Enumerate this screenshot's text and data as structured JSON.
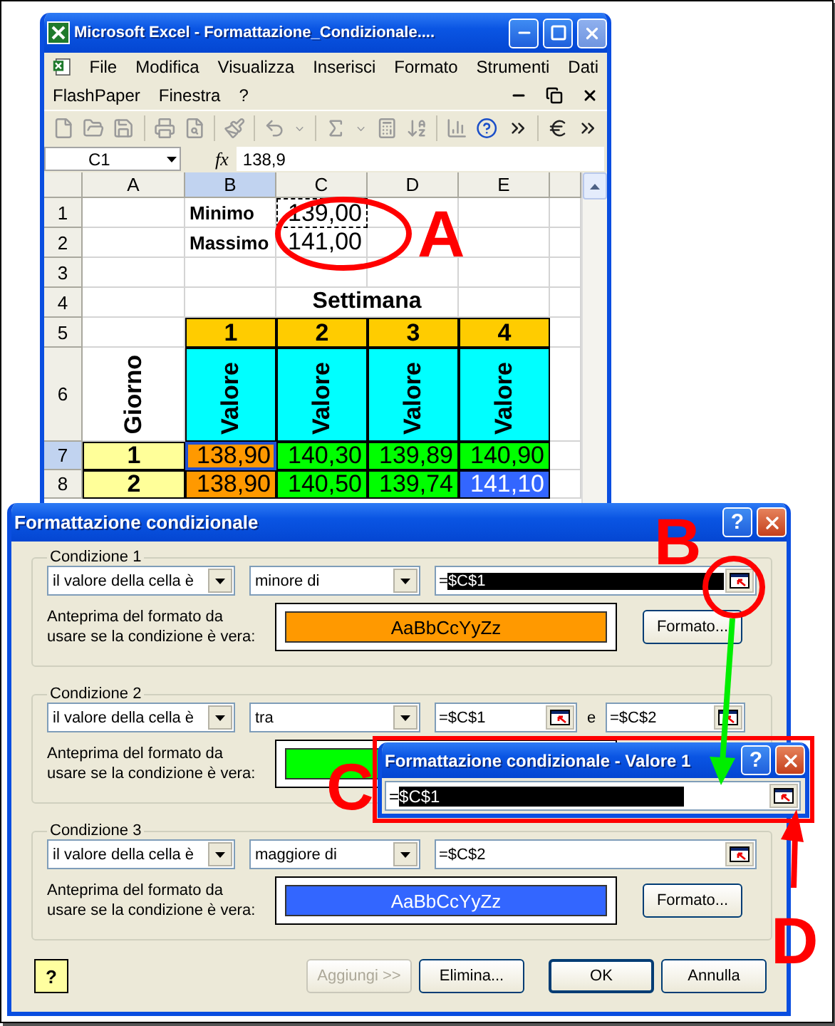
{
  "excel": {
    "title": "Microsoft Excel - Formattazione_Condizionale....",
    "menus": [
      [
        "File",
        "Modifica",
        "Visualizza",
        "Inserisci",
        "Formato",
        "Strumenti",
        "Dati"
      ],
      [
        "FlashPaper",
        "Finestra",
        "?"
      ]
    ],
    "name_box": "C1",
    "fx": "fx",
    "formula": "138,9",
    "columns": [
      {
        "label": "A",
        "selected": false
      },
      {
        "label": "B",
        "selected": true
      },
      {
        "label": "C",
        "selected": false
      },
      {
        "label": "D",
        "selected": false
      },
      {
        "label": "E",
        "selected": false
      }
    ],
    "rows": [
      {
        "header": "1",
        "selected": false,
        "cells": [
          {
            "kind": "empty"
          },
          {
            "kind": "label",
            "text": "Minimo"
          },
          {
            "kind": "reference",
            "text": "139,00"
          },
          {
            "kind": "empty"
          },
          {
            "kind": "empty"
          }
        ]
      },
      {
        "header": "2",
        "selected": false,
        "cells": [
          {
            "kind": "empty"
          },
          {
            "kind": "label",
            "text": "Massimo"
          },
          {
            "kind": "value",
            "text": "141,00"
          },
          {
            "kind": "empty"
          },
          {
            "kind": "empty"
          }
        ]
      },
      {
        "header": "3",
        "selected": false,
        "cells": [
          {
            "kind": "empty"
          },
          {
            "kind": "empty"
          },
          {
            "kind": "empty"
          },
          {
            "kind": "empty"
          },
          {
            "kind": "empty"
          }
        ]
      },
      {
        "header": "4",
        "selected": false,
        "cells": [
          {
            "kind": "empty"
          },
          {
            "kind": "empty"
          },
          {
            "kind": "title",
            "text": "Settimana"
          },
          {
            "kind": "empty"
          }
        ]
      },
      {
        "header": "5",
        "selected": false,
        "cells": [
          {
            "kind": "empty"
          },
          {
            "kind": "heading",
            "text": "1",
            "color": "#ffcc00"
          },
          {
            "kind": "heading",
            "text": "2",
            "color": "#ffcc00"
          },
          {
            "kind": "heading",
            "text": "3",
            "color": "#ffcc00"
          },
          {
            "kind": "heading",
            "text": "4",
            "color": "#ffcc00"
          }
        ]
      },
      {
        "header": "6",
        "selected": false,
        "cells": [
          {
            "kind": "vertical",
            "text": "Giorno"
          },
          {
            "kind": "vertical",
            "text": "Valore",
            "color": "#00ffff"
          },
          {
            "kind": "vertical",
            "text": "Valore",
            "color": "#00ffff"
          },
          {
            "kind": "vertical",
            "text": "Valore",
            "color": "#00ffff"
          },
          {
            "kind": "vertical",
            "text": "Valore",
            "color": "#00ffff"
          }
        ]
      },
      {
        "header": "7",
        "selected": true,
        "cells": [
          {
            "kind": "heading",
            "text": "1",
            "color": "#ffff99"
          },
          {
            "kind": "data",
            "text": "138,90",
            "color": "#ff9900",
            "selected": true
          },
          {
            "kind": "data",
            "text": "140,30",
            "color": "#00ff00",
            "selected": false
          },
          {
            "kind": "data",
            "text": "139,89",
            "color": "#00ff00",
            "selected": false
          },
          {
            "kind": "data",
            "text": "140,90",
            "color": "#00ff00",
            "selected": false
          }
        ]
      },
      {
        "header": "8",
        "selected": false,
        "cells": [
          {
            "kind": "heading",
            "text": "2",
            "color": "#ffff99"
          },
          {
            "kind": "data",
            "text": "138,90",
            "color": "#ff9900",
            "selected": false
          },
          {
            "kind": "data",
            "text": "140,50",
            "color": "#00ff00",
            "selected": false
          },
          {
            "kind": "data",
            "text": "139,74",
            "color": "#00ff00",
            "selected": false
          },
          {
            "kind": "data",
            "text": "141,10",
            "color": "#3366ff",
            "font": {
              "color": "#ffffff"
            },
            "selected": false
          }
        ]
      }
    ]
  },
  "dialog": {
    "title": "Formattazione condizionale",
    "help": "?",
    "conditions": [
      {
        "label": "Condizione 1",
        "operand": "il valore della cella è",
        "operator": "minore di",
        "fields": [
          {
            "value": "=$C$1",
            "highlighted": true
          }
        ],
        "preview_label": "Anteprima del formato da usare se la condizione è vera:",
        "preview": {
          "color": "#ff9900",
          "text": "AaBbCcYyZz",
          "font": {
            "color": "#000000"
          }
        },
        "format_button": "Formato..."
      },
      {
        "label": "Condizione 2",
        "operand": "il valore della cella è",
        "operator": "tra",
        "fields": [
          {
            "value": "=$C$1",
            "highlighted": false
          },
          {
            "value": "=$C$2",
            "highlighted": false
          }
        ],
        "joiner": "e",
        "preview_label": "Anteprima del formato da usare se la condizione è vera:",
        "preview": {
          "color": "#00ff00"
        }
      },
      {
        "label": "Condizione 3",
        "operand": "il valore della cella è",
        "operator": "maggiore di",
        "fields": [
          {
            "value": "=$C$2",
            "highlighted": false
          }
        ],
        "preview_label": "Anteprima del formato da usare se la condizione è vera:",
        "preview": {
          "color": "#3366ff",
          "text": "AaBbCcYyZz",
          "font": {
            "color": "#ffffff"
          }
        },
        "format_button": "Formato..."
      }
    ],
    "assistant": "?",
    "buttons": [
      {
        "label": "Aggiungi >>",
        "disabled": true,
        "default": false
      },
      {
        "label": "Elimina...",
        "disabled": false,
        "default": false
      },
      {
        "label": "OK",
        "disabled": false,
        "default": true
      },
      {
        "label": "Annulla",
        "disabled": false,
        "default": false
      }
    ]
  },
  "subdialog": {
    "title": "Formattazione condizionale - Valore 1",
    "help": "?",
    "field": {
      "value": "=$C$1",
      "highlighted": true
    }
  },
  "annotations": [
    {
      "text": "A"
    },
    {
      "text": "B"
    },
    {
      "text": "C"
    },
    {
      "text": "D"
    }
  ]
}
